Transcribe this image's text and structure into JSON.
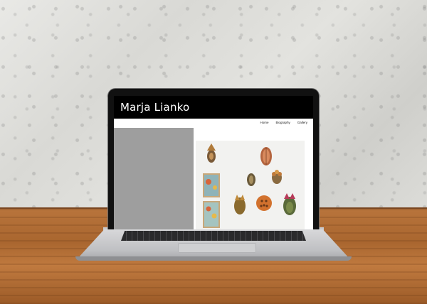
{
  "site": {
    "title": "Marja Lianko",
    "nav": [
      "Home",
      "Biography",
      "Gallery"
    ]
  },
  "colors": {
    "header_bg": "#000000",
    "sidebar_bg": "#9e9e9e",
    "table_wood": "#b8743c",
    "wall": "#e0e0dc"
  }
}
